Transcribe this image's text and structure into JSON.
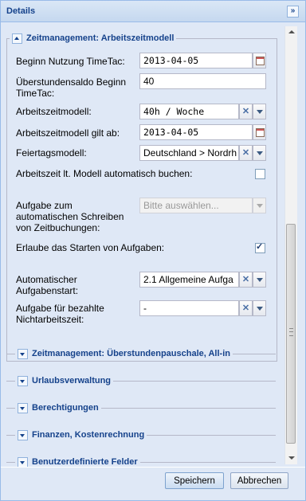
{
  "panel": {
    "title": "Details",
    "collapse_icon": "double-chevron-right-icon"
  },
  "section_main": {
    "title": "Zeitmanagement: Arbeitszeitmodell",
    "fields": {
      "beginn_nutzung": {
        "label": "Beginn Nutzung TimeTac:",
        "value": "2013-04-05"
      },
      "ueberstundensaldo": {
        "label": "Überstundensaldo Beginn TimeTac:",
        "value": "40"
      },
      "arbeitszeitmodell": {
        "label": "Arbeitszeitmodell:",
        "value": "40h / Woche"
      },
      "gilt_ab": {
        "label": "Arbeitszeitmodell gilt ab:",
        "value": "2013-04-05"
      },
      "feiertagsmodell": {
        "label": "Feiertagsmodell:",
        "value": "Deutschland > Nordrh"
      },
      "auto_buchen": {
        "label": "Arbeitszeit lt. Modell automatisch buchen:",
        "checked": false
      },
      "aufgabe_auto": {
        "label": "Aufgabe zum automatischen Schreiben von Zeitbuchungen:",
        "placeholder": "Bitte auswählen...",
        "disabled": true
      },
      "starten": {
        "label": "Erlaube das Starten von Aufgaben:",
        "checked": true
      },
      "auto_aufgabenstart": {
        "label": "Automatischer Aufgabenstart:",
        "value": "2.1 Allgemeine Aufga"
      },
      "nichtarbeitszeit": {
        "label": "Aufgabe für bezahlte Nichtarbeitszeit:",
        "value": "-"
      }
    }
  },
  "collapsed_sections": [
    {
      "title": "Zeitmanagement: Überstundenpauschale, All-in"
    },
    {
      "title": "Urlaubsverwaltung"
    },
    {
      "title": "Berechtigungen"
    },
    {
      "title": "Finanzen, Kostenrechnung"
    },
    {
      "title": "Benutzerdefinierte Felder"
    }
  ],
  "footer": {
    "save_label": "Speichern",
    "cancel_label": "Abbrechen"
  },
  "icons": {
    "date": "calendar-icon",
    "clear": "clear-icon",
    "dropdown": "chevron-down-icon"
  },
  "colors": {
    "header_text": "#15428b",
    "body_bg": "#dfe8f6",
    "border": "#99bbe8"
  }
}
